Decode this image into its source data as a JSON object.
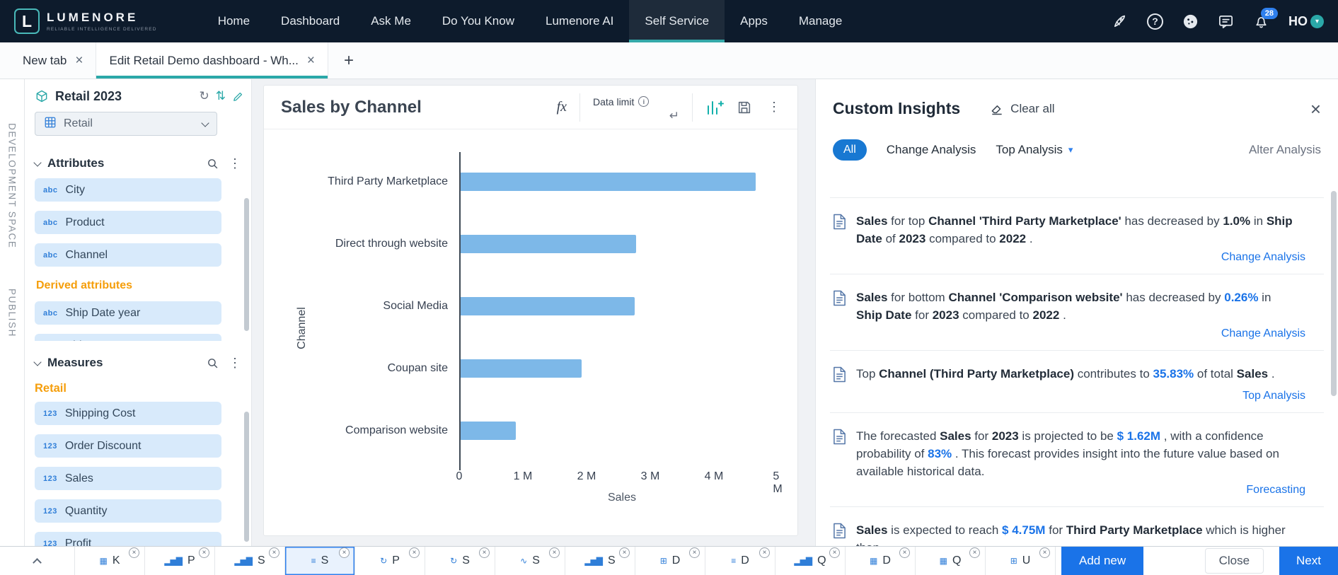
{
  "theme": {
    "accent_teal": "#2aa8a8",
    "primary_blue": "#1a73e8",
    "chip_blue": "#1878d2",
    "orange": "#f59e0b",
    "bar_color": "#7db8e8"
  },
  "navbar": {
    "logo": {
      "mark": "L",
      "name": "LUMENORE",
      "tagline": "RELIABLE INTELLIGENCE DELIVERED"
    },
    "items": [
      {
        "label": "Home",
        "active": false
      },
      {
        "label": "Dashboard",
        "active": false
      },
      {
        "label": "Ask Me",
        "active": false
      },
      {
        "label": "Do You Know",
        "active": false
      },
      {
        "label": "Lumenore AI",
        "active": false
      },
      {
        "label": "Self Service",
        "active": true
      },
      {
        "label": "Apps",
        "active": false
      },
      {
        "label": "Manage",
        "active": false
      }
    ],
    "notification_count": "28",
    "user_initials": "HO"
  },
  "tab_bar": {
    "tabs": [
      {
        "label": "New tab",
        "active": false
      },
      {
        "label": "Edit Retail Demo dashboard - Wh...",
        "active": true
      }
    ],
    "add_tab_label": "+"
  },
  "side_strip": {
    "top_label": "DEVELOPMENT SPACE",
    "bottom_label": "PUBLISH"
  },
  "data_panel": {
    "dataset_name": "Retail 2023",
    "table_name": "Retail",
    "attributes": {
      "title": "Attributes",
      "items": [
        {
          "label": "City",
          "icon": "abc",
          "heading": false
        },
        {
          "label": "Product",
          "icon": "abc",
          "heading": false
        },
        {
          "label": "Channel",
          "icon": "abc",
          "heading": false
        },
        {
          "label": "Derived attributes",
          "heading": true
        },
        {
          "label": "Ship Date year",
          "icon": "abc",
          "heading": false
        },
        {
          "label": "Ship Date quarter",
          "icon": "abc",
          "heading": false
        }
      ]
    },
    "measures": {
      "title": "Measures",
      "group_label": "Retail",
      "items": [
        {
          "label": "Shipping Cost",
          "icon": "123"
        },
        {
          "label": "Order Discount",
          "icon": "123"
        },
        {
          "label": "Sales",
          "icon": "123"
        },
        {
          "label": "Quantity",
          "icon": "123"
        },
        {
          "label": "Profit",
          "icon": "123"
        }
      ]
    }
  },
  "widget": {
    "title": "Sales by Channel",
    "fx_label": "fx",
    "data_limit_label": "Data limit"
  },
  "chart_data": {
    "type": "bar",
    "orientation": "horizontal",
    "title": "Sales by Channel",
    "categories": [
      "Third Party Marketplace",
      "Direct through website",
      "Social Media",
      "Coupan site",
      "Comparison website"
    ],
    "values": [
      4650000,
      2780000,
      2760000,
      1920000,
      890000
    ],
    "xlabel": "Sales",
    "ylabel": "Channel",
    "xlim": [
      0,
      5000000
    ],
    "x_ticks": [
      "0",
      "1 M",
      "2 M",
      "3 M",
      "4 M",
      "5 M"
    ],
    "tick_unit": 1000000,
    "bar_color": "#7db8e8",
    "grid": false,
    "legend": false
  },
  "insights": {
    "title": "Custom Insights",
    "clear_all_label": "Clear all",
    "filters": [
      {
        "label": "All",
        "active": true,
        "dropdown": false
      },
      {
        "label": "Change Analysis",
        "active": false,
        "dropdown": false
      },
      {
        "label": "Top Analysis",
        "active": false,
        "dropdown": true
      }
    ],
    "alter_analysis_label": "Alter Analysis",
    "cards": [
      {
        "clipped": false,
        "segments": [
          {
            "t": "Sales",
            "b": true
          },
          {
            "t": " for top "
          },
          {
            "t": "Channel 'Third Party Marketplace'",
            "b": true
          },
          {
            "t": " has decreased by "
          },
          {
            "t": "1.0%",
            "b": true
          },
          {
            "t": " in "
          },
          {
            "t": "Ship Date",
            "b": true
          },
          {
            "t": " of "
          },
          {
            "t": "2023",
            "b": true
          },
          {
            "t": " compared to "
          },
          {
            "t": "2022",
            "b": true
          },
          {
            "t": "."
          }
        ],
        "link": "Change Analysis"
      },
      {
        "clipped": false,
        "segments": [
          {
            "t": "Sales",
            "b": true
          },
          {
            "t": " for bottom "
          },
          {
            "t": "Channel 'Comparison website'",
            "b": true
          },
          {
            "t": " has decreased by "
          },
          {
            "t": "0.26%",
            "b": true,
            "blue": true
          },
          {
            "t": " in "
          },
          {
            "t": "Ship Date",
            "b": true
          },
          {
            "t": " for "
          },
          {
            "t": "2023",
            "b": true
          },
          {
            "t": " compared to "
          },
          {
            "t": "2022",
            "b": true
          },
          {
            "t": "."
          }
        ],
        "link": "Change Analysis"
      },
      {
        "clipped": false,
        "segments": [
          {
            "t": "Top "
          },
          {
            "t": "Channel (Third Party Marketplace)",
            "b": true
          },
          {
            "t": " contributes to "
          },
          {
            "t": "35.83%",
            "b": true,
            "blue": true
          },
          {
            "t": " of total "
          },
          {
            "t": "Sales",
            "b": true
          },
          {
            "t": "."
          }
        ],
        "link": "Top Analysis"
      },
      {
        "clipped": false,
        "segments": [
          {
            "t": "The forecasted "
          },
          {
            "t": "Sales",
            "b": true
          },
          {
            "t": " for "
          },
          {
            "t": "2023",
            "b": true
          },
          {
            "t": " is projected to be "
          },
          {
            "t": "$ 1.62M",
            "b": true,
            "blue": true
          },
          {
            "t": ", with a confidence probability of "
          },
          {
            "t": "83%",
            "b": true,
            "blue": true
          },
          {
            "t": ". This forecast provides insight into the future value based on available historical data."
          }
        ],
        "link": "Forecasting"
      },
      {
        "clipped": true,
        "segments": [
          {
            "t": "Sales",
            "b": true
          },
          {
            "t": " is expected to reach "
          },
          {
            "t": "$ 4.75M",
            "b": true,
            "blue": true
          },
          {
            "t": " for "
          },
          {
            "t": "Third Party Marketplace",
            "b": true
          },
          {
            "t": " which is higher than"
          }
        ],
        "link": ""
      }
    ]
  },
  "bottom_bar": {
    "widget_tabs": [
      {
        "letter": "K",
        "icon": "grid",
        "active": false
      },
      {
        "letter": "P",
        "icon": "bar",
        "active": false
      },
      {
        "letter": "S",
        "icon": "bar",
        "active": false
      },
      {
        "letter": "S",
        "icon": "hbar",
        "active": true
      },
      {
        "letter": "P",
        "icon": "refresh",
        "active": false
      },
      {
        "letter": "S",
        "icon": "refresh",
        "active": false
      },
      {
        "letter": "S",
        "icon": "line",
        "active": false
      },
      {
        "letter": "S",
        "icon": "bar",
        "active": false
      },
      {
        "letter": "D",
        "icon": "table",
        "active": false
      },
      {
        "letter": "D",
        "icon": "hbar",
        "active": false
      },
      {
        "letter": "Q",
        "icon": "bar",
        "active": false
      },
      {
        "letter": "D",
        "icon": "grid",
        "active": false
      },
      {
        "letter": "Q",
        "icon": "grid",
        "active": false
      },
      {
        "letter": "U",
        "icon": "table",
        "active": false
      }
    ],
    "add_new_label": "Add new",
    "close_label": "Close",
    "next_label": "Next"
  }
}
